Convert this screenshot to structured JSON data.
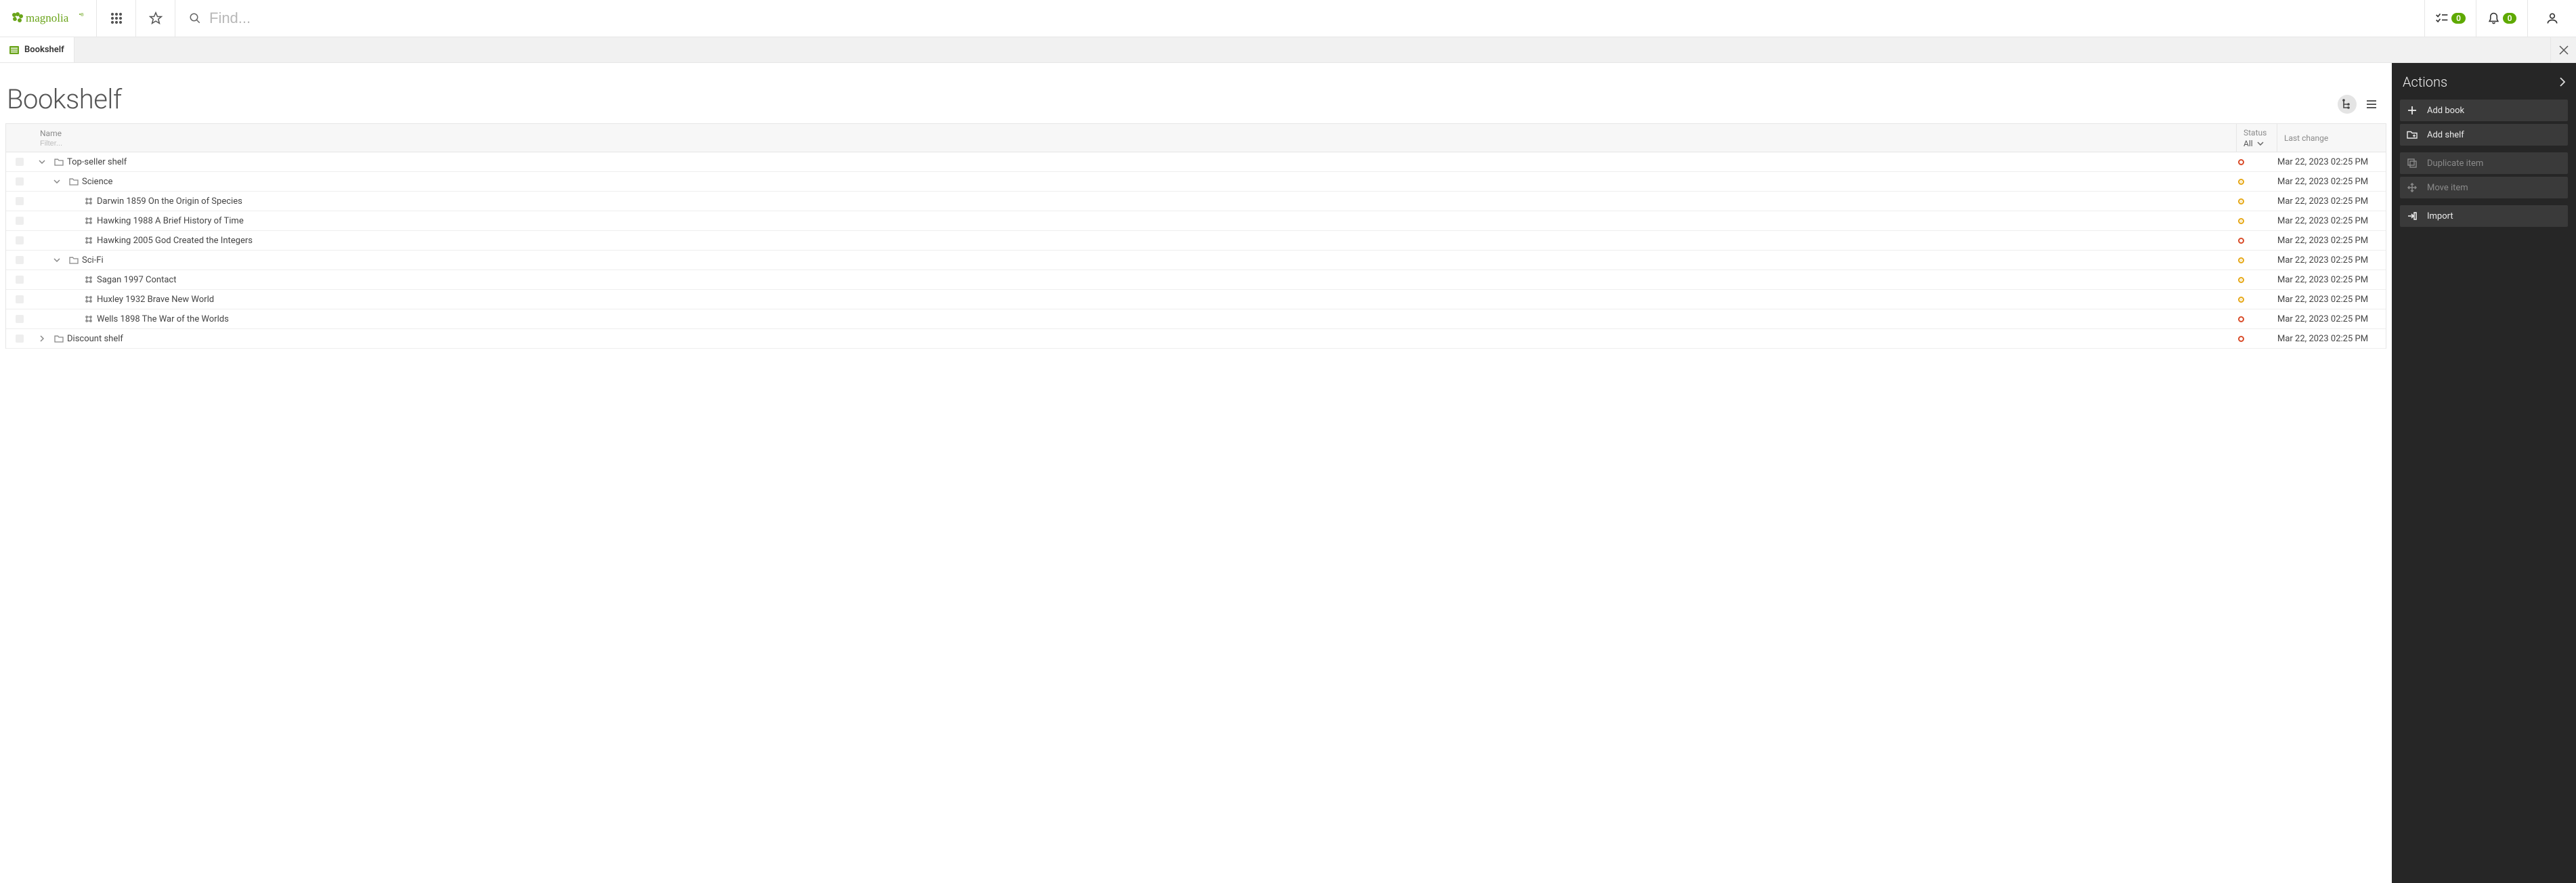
{
  "topbar": {
    "search_placeholder": "Find...",
    "tasks_badge": "0",
    "notifications_badge": "0"
  },
  "tab": {
    "label": "Bookshelf"
  },
  "page": {
    "title": "Bookshelf"
  },
  "columns": {
    "name_label": "Name",
    "name_filter_placeholder": "Filter...",
    "status_label": "Status",
    "status_filter_value": "All",
    "lastchange_label": "Last change"
  },
  "rows": [
    {
      "indent": 0,
      "expander": "down",
      "kind": "folder",
      "name": "Top-seller shelf",
      "status": "red",
      "date": "Mar 22, 2023 02:25 PM"
    },
    {
      "indent": 1,
      "expander": "down",
      "kind": "folder",
      "name": "Science",
      "status": "amber",
      "date": "Mar 22, 2023 02:25 PM"
    },
    {
      "indent": 2,
      "expander": "none",
      "kind": "item",
      "name": "Darwin 1859 On the Origin of Species",
      "status": "amber",
      "date": "Mar 22, 2023 02:25 PM"
    },
    {
      "indent": 2,
      "expander": "none",
      "kind": "item",
      "name": "Hawking 1988 A Brief History of Time",
      "status": "amber",
      "date": "Mar 22, 2023 02:25 PM"
    },
    {
      "indent": 2,
      "expander": "none",
      "kind": "item",
      "name": "Hawking 2005 God Created the Integers",
      "status": "red",
      "date": "Mar 22, 2023 02:25 PM"
    },
    {
      "indent": 1,
      "expander": "down",
      "kind": "folder",
      "name": "Sci-Fi",
      "status": "amber",
      "date": "Mar 22, 2023 02:25 PM"
    },
    {
      "indent": 2,
      "expander": "none",
      "kind": "item",
      "name": "Sagan 1997 Contact",
      "status": "amber",
      "date": "Mar 22, 2023 02:25 PM"
    },
    {
      "indent": 2,
      "expander": "none",
      "kind": "item",
      "name": "Huxley 1932 Brave New World",
      "status": "amber",
      "date": "Mar 22, 2023 02:25 PM"
    },
    {
      "indent": 2,
      "expander": "none",
      "kind": "item",
      "name": "Wells 1898 The War of the Worlds",
      "status": "red",
      "date": "Mar 22, 2023 02:25 PM"
    },
    {
      "indent": 0,
      "expander": "right",
      "kind": "folder",
      "name": "Discount shelf",
      "status": "red",
      "date": "Mar 22, 2023 02:25 PM"
    }
  ],
  "actions": {
    "title": "Actions",
    "groups": [
      [
        {
          "id": "add-book",
          "label": "Add book",
          "icon": "plus",
          "enabled": true
        },
        {
          "id": "add-shelf",
          "label": "Add shelf",
          "icon": "folder+",
          "enabled": true
        }
      ],
      [
        {
          "id": "duplicate",
          "label": "Duplicate item",
          "icon": "duplicate",
          "enabled": false
        },
        {
          "id": "move",
          "label": "Move item",
          "icon": "move",
          "enabled": false
        }
      ],
      [
        {
          "id": "import",
          "label": "Import",
          "icon": "import",
          "enabled": true
        }
      ]
    ]
  }
}
